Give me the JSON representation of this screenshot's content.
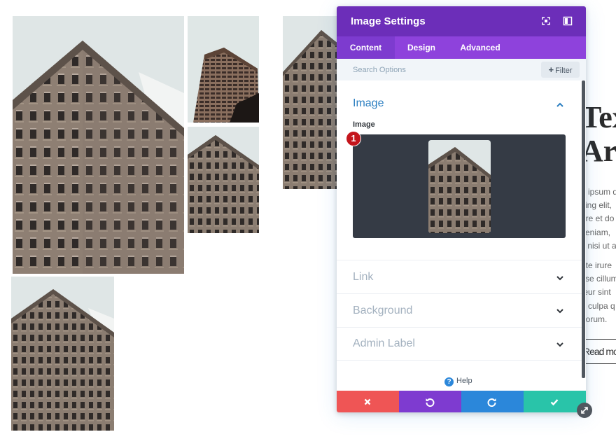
{
  "colors": {
    "header_purple": "#6c2eb9",
    "tab_purple": "#8e42dc",
    "active_blue": "#2c7fc1",
    "cancel_red": "#ef5555",
    "undo_purple": "#7e3bd0",
    "redo_blue": "#2b87da",
    "save_green": "#29c4a9",
    "badge_red": "#c4151c"
  },
  "page": {
    "heading_line_1": "Tex",
    "heading_line_2": "Arc",
    "paragraph_1": [
      "n ipsum d",
      "cing elit,",
      "ore et do",
      "veniam,",
      "s nisi ut a"
    ],
    "paragraph_2": [
      "ute irure",
      "sse cillum",
      "teur sint",
      "n culpa q",
      "borum."
    ],
    "read_more_label": "Read mo"
  },
  "modal": {
    "title": "Image Settings",
    "header_icons": [
      "expand-icon",
      "sidebar-icon"
    ],
    "tabs": [
      {
        "label": "Content",
        "active": true
      },
      {
        "label": "Design",
        "active": false
      },
      {
        "label": "Advanced",
        "active": false
      }
    ],
    "search": {
      "placeholder": "Search Options",
      "filter_label": "Filter"
    },
    "sections": [
      {
        "title": "Image",
        "open": true
      },
      {
        "title": "Link",
        "open": false
      },
      {
        "title": "Background",
        "open": false
      },
      {
        "title": "Admin Label",
        "open": false
      }
    ],
    "image_field_label": "Image",
    "step_badge": "1",
    "help_label": "Help",
    "footer_icons": [
      "close-icon",
      "undo-icon",
      "redo-icon",
      "check-icon"
    ]
  }
}
